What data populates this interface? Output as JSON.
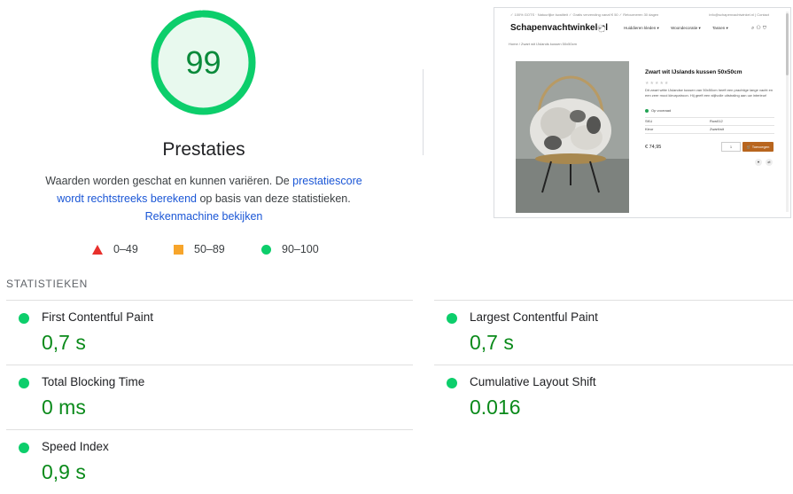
{
  "score": {
    "value": "99",
    "fraction": 0.99,
    "label": "Prestaties",
    "ring_color": "#0cce6b",
    "fill_color": "#e8f9ee",
    "text_color": "#0a8a3a"
  },
  "description": {
    "part1": "Waarden worden geschat en kunnen variëren. De ",
    "link1": "prestatiescore wordt rechtstreeks berekend",
    "part2": " op basis van deze statistieken. ",
    "link2": "Rekenmachine bekijken"
  },
  "legend": [
    {
      "icon": "triangle-icon",
      "color": "#e8302c",
      "label": "0–49"
    },
    {
      "icon": "square-icon",
      "color": "#f7a52b",
      "label": "50–89"
    },
    {
      "icon": "circle-icon",
      "color": "#0cce6b",
      "label": "90–100"
    }
  ],
  "screenshot": {
    "topbar_left": "✓ 100% GOTS · Natuurlijke kwaliteit   ✓ Gratis verzending vanaf € 50   ✓ Retourneren 30 dagen",
    "topbar_right": "info@schapenvachtwinkel.nl  |  Contact",
    "logo": "Schapenvachtwinkel.nl",
    "nav": [
      "Huiddieren kleden ▾",
      "Woondecoratie ▾",
      "Tassen ▾"
    ],
    "breadcrumb": "Home  /  Zwart wit IJslands kussen 50x50cm",
    "product_title": "Zwart wit IJslands kussen 50x50cm",
    "product_desc": "Dit zwart witte IJslandse kussen van 50x50cm heeft een prachtige lange vacht en een zeer mooi kleurpatroon. Hij geeft een stijlvolle uitstraling aan uw interieur!",
    "stock": "Op voorraad",
    "specs": [
      {
        "k": "SKU",
        "v": "Ruw012"
      },
      {
        "k": "Kleur",
        "v": "Zwart/wit"
      }
    ],
    "price": "€ 74,95",
    "qty": "1",
    "cart": "Toevoegen"
  },
  "metrics": {
    "header": "STATISTIEKEN",
    "items": [
      {
        "name": "First Contentful Paint",
        "value": "0,7 s",
        "status_color": "#0cce6b"
      },
      {
        "name": "Largest Contentful Paint",
        "value": "0,7 s",
        "status_color": "#0cce6b"
      },
      {
        "name": "Total Blocking Time",
        "value": "0 ms",
        "status_color": "#0cce6b"
      },
      {
        "name": "Cumulative Layout Shift",
        "value": "0.016",
        "status_color": "#0cce6b"
      },
      {
        "name": "Speed Index",
        "value": "0,9 s",
        "status_color": "#0cce6b"
      }
    ]
  }
}
